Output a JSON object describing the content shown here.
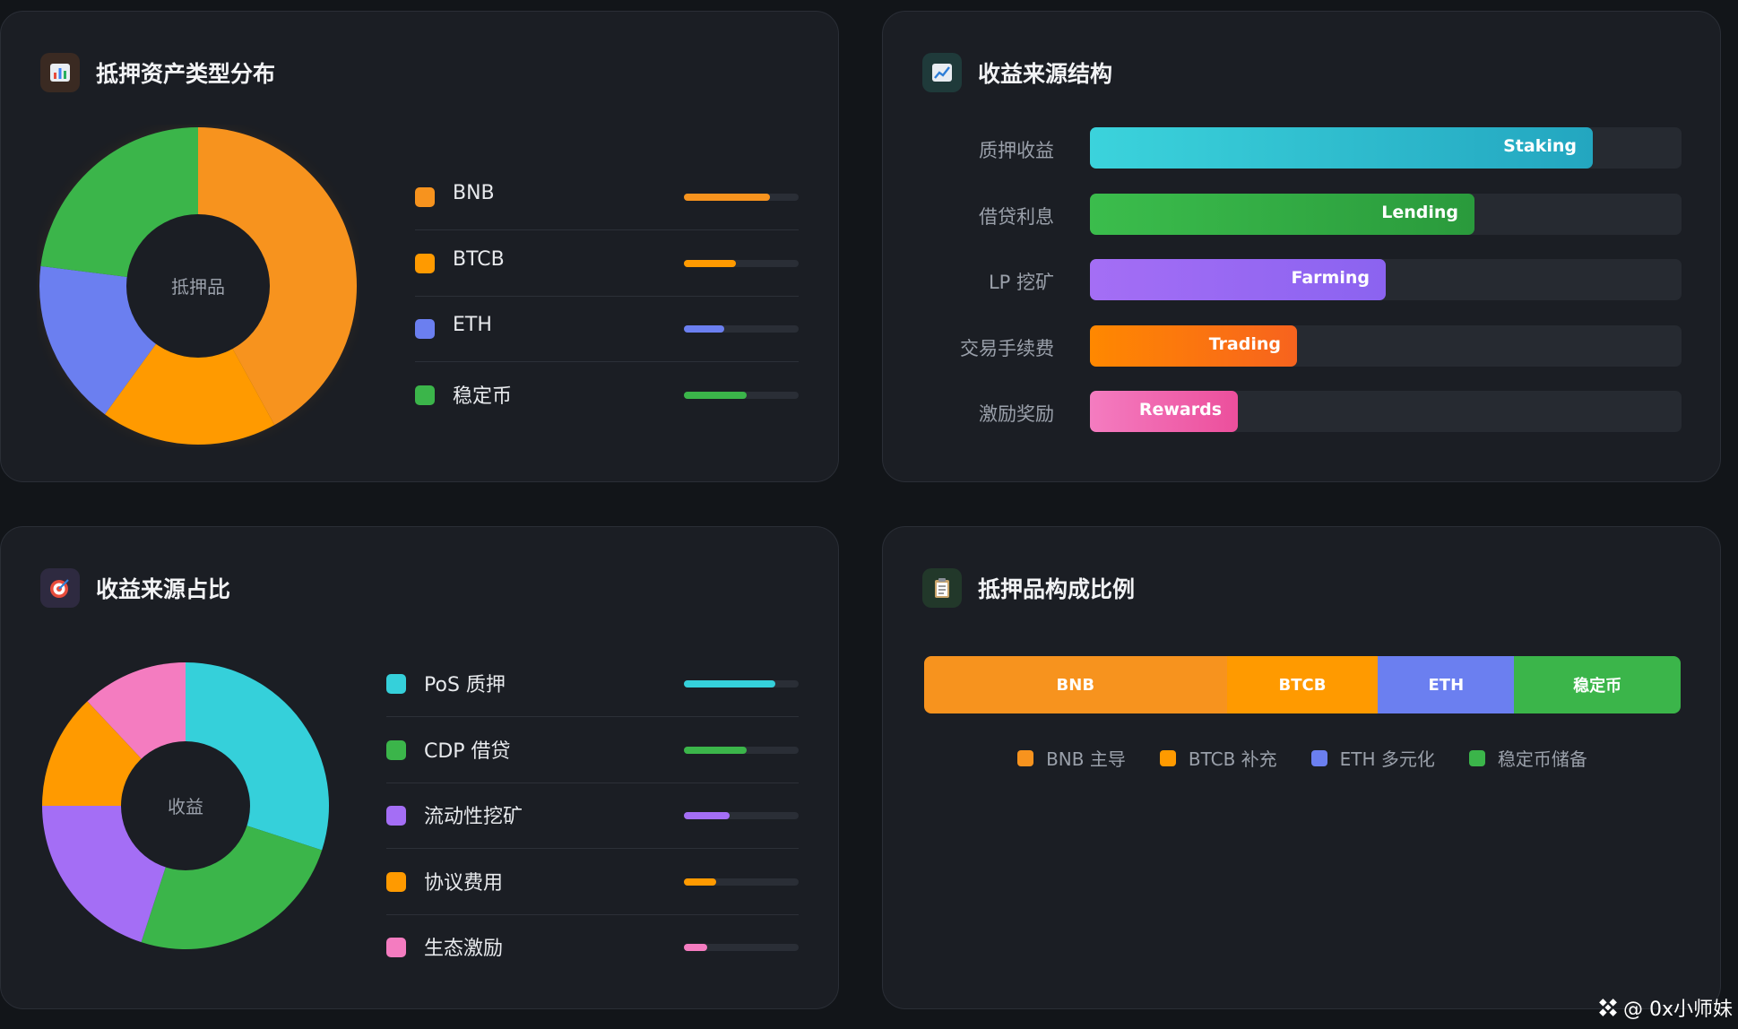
{
  "panels": {
    "collateral_types": {
      "title": "抵押资产类型分布",
      "center_label": "抵押品"
    },
    "revenue_structure": {
      "title": "收益来源结构"
    },
    "revenue_share": {
      "title": "收益来源占比",
      "center_label": "收益"
    },
    "collateral_ratio": {
      "title": "抵押品构成比例"
    }
  },
  "colors": {
    "orange": "#f7931e",
    "orange2": "#ff9a00",
    "blue": "#6b7ff0",
    "green": "#3bb54a",
    "cyan": "#35d0da",
    "purple": "#a46ef5",
    "pink": "#f47cc0"
  },
  "icons": {
    "collateral_types": "bar-chart-icon",
    "revenue_structure": "trend-chart-icon",
    "revenue_share": "target-icon",
    "collateral_ratio": "clipboard-icon"
  },
  "chart_data": [
    {
      "type": "pie",
      "categories": [
        "BNB",
        "BTCB",
        "ETH",
        "稳定币"
      ],
      "values": [
        42,
        18,
        17,
        23
      ],
      "colors": [
        "#f7931e",
        "#ff9a00",
        "#6b7ff0",
        "#3bb54a"
      ],
      "legend_bar_values": [
        0.75,
        0.45,
        0.35,
        0.55
      ]
    },
    {
      "type": "bar",
      "orientation": "horizontal",
      "categories": [
        "质押收益",
        "借贷利息",
        "LP 挖矿",
        "交易手续费",
        "激励奖励"
      ],
      "bar_labels": [
        "Staking",
        "Lending",
        "Farming",
        "Trading",
        "Rewards"
      ],
      "values": [
        85,
        65,
        50,
        35,
        25
      ],
      "xlim": [
        0,
        100
      ]
    },
    {
      "type": "pie",
      "categories": [
        "PoS 质押",
        "CDP 借贷",
        "流动性挖矿",
        "协议费用",
        "生态激励"
      ],
      "values": [
        30,
        25,
        20,
        13,
        12
      ],
      "colors": [
        "#35d0da",
        "#3bb54a",
        "#a46ef5",
        "#ff9a00",
        "#f47cc0"
      ],
      "legend_bar_values": [
        0.8,
        0.55,
        0.4,
        0.28,
        0.2
      ]
    },
    {
      "type": "bar",
      "orientation": "stacked-horizontal",
      "categories": [
        "BNB",
        "BTCB",
        "ETH",
        "稳定币"
      ],
      "values": [
        40,
        20,
        18,
        22
      ],
      "legend": [
        "BNB 主导",
        "BTCB 补充",
        "ETH 多元化",
        "稳定币储备"
      ]
    }
  ],
  "watermark": "@ 0x小师妹"
}
